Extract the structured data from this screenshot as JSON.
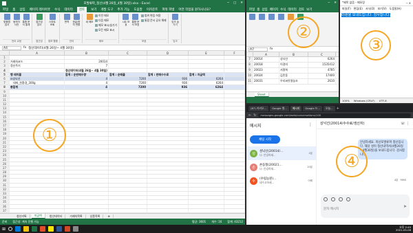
{
  "excel_main": {
    "title": "포발류파_청산(4월 26일_4월 30일).xlsx - Excel",
    "menu": [
      "파일",
      "홈",
      "삽입",
      "페이지 레이아웃",
      "수식",
      "데이터",
      "검토",
      "보기",
      "개발 도구",
      "추가 기능",
      "도움말",
      "이카운트",
      "파워 피벗",
      "어떤 작업을 원하시나요?"
    ],
    "active_menu": "검토",
    "ribbon_groups": [
      {
        "label": "언어 교정",
        "buttons": [
          "맞춤법 검사",
          "동의어 사전",
          "통합 문서 통계"
        ]
      },
      {
        "label": "접근성",
        "buttons": [
          "접근성 검사"
        ]
      },
      {
        "label": "정보 활용",
        "buttons": [
          "스마트 조회"
        ]
      },
      {
        "label": "언어",
        "buttons": [
          "번역",
          "한글/한자 변환"
        ]
      },
      {
        "label": "메모",
        "buttons": [
          "새 메모"
        ],
        "items": [
          "이전 메모",
          "다음 메모",
          "메모 표시/숨기기",
          "모든 메모 표시"
        ]
      },
      {
        "label": "보호",
        "buttons": [
          "시트 보호",
          "통합 문서 보호"
        ],
        "items": [
          "범위 편집 허용",
          "통합 문서 공유 해제"
        ]
      },
      {
        "label": "잉크",
        "buttons": [
          "잉크 숨기기"
        ]
      }
    ],
    "name_box": "A4",
    "formula": "청산데이터(4월 26일~ 4월 30일)",
    "col_headers": [
      "A",
      "B",
      "C",
      "D",
      "E",
      "F"
    ],
    "rows": [
      {
        "n": "1",
        "cells": [
          "",
          "",
          "",
          "",
          "",
          ""
        ]
      },
      {
        "n": "2",
        "cells": [
          "거래처코드",
          "20014",
          "",
          "",
          "",
          ""
        ]
      },
      {
        "n": "3",
        "cells": [
          "정산주기",
          "7",
          "",
          "",
          "",
          ""
        ]
      },
      {
        "n": "4",
        "cells": [
          "",
          "청산데이터(4월 26일~ 4월 30일)",
          "",
          "",
          "",
          ""
        ]
      },
      {
        "n": "5",
        "cells": [
          "행 레이블",
          "합계 : 순판매수량",
          "합계 : 순매출",
          "합계 : 판매수수료",
          "합계 : 지급액",
          ""
        ]
      },
      {
        "n": "6",
        "cells": [
          "⊟성낙선",
          "4",
          "7200",
          "936",
          "6264",
          ""
        ]
      },
      {
        "n": "7",
        "cells": [
          "대파_친환경_300g",
          "4",
          "7200",
          "936",
          "6264",
          ""
        ]
      },
      {
        "n": "8",
        "cells": [
          "총합계",
          "4",
          "7200",
          "936",
          "6264",
          ""
        ]
      }
    ],
    "empty_rows": [
      "9",
      "10",
      "11",
      "12",
      "13",
      "14",
      "15",
      "16",
      "17",
      "18",
      "19",
      "20",
      "21",
      "22",
      "23",
      "24",
      "25",
      "26",
      "27",
      "28",
      "29",
      "30",
      "31",
      "32",
      "33",
      "34",
      "35",
      "36",
      "37"
    ],
    "sheet_tabs": [
      "청산카톡",
      "지급액",
      "청산데이터",
      "거래처목록",
      "상품목록"
    ],
    "active_tab": "지급액",
    "status": {
      "ready": "준비",
      "avg": "평균: 3601",
      "count": "개수: 16",
      "sum": "합계: 43212",
      "access": "접근성: 계속 진행 가능"
    }
  },
  "excel_small": {
    "menu": [
      "파일",
      "홈",
      "삽입",
      "페이지",
      "수식",
      "데이터",
      "검토",
      "보기"
    ],
    "name_box": "A7",
    "col_headers": [
      "A",
      "B",
      "C"
    ],
    "rows": [
      {
        "n": "7",
        "cells": [
          "20014",
          "성낙선",
          "6264"
        ]
      },
      {
        "n": "8",
        "cells": [
          "20018",
          "이경미",
          "1535412"
        ]
      },
      {
        "n": "9",
        "cells": [
          "20023",
          "서명희",
          "4785"
        ]
      },
      {
        "n": "10",
        "cells": [
          "20024",
          "김민동",
          "17400"
        ]
      },
      {
        "n": "11",
        "cells": [
          "20031",
          "우리씨앗영농조",
          "2610"
        ]
      }
    ],
    "tab": "Sheet"
  },
  "notepad": {
    "title": "*제목 없음 - 메모장",
    "menu": [
      "파일(F)",
      "편집(E)",
      "서식(O)",
      "보기(V)",
      "도움말(H)"
    ],
    "text_plain": "",
    "text_selected": "0)원을 보내드립니다. 감사합니다.",
    "status": [
      "100%",
      "Windows (CRLF)",
      "UTF-8"
    ]
  },
  "chrome": {
    "tabs": [
      "(87) 카카오...",
      "Google 캘...",
      "메시지",
      "Google 드...",
      "오늘..."
    ],
    "active_tab": "메시지",
    "url": "messages.google.com/web/conversations/100",
    "sidebar_title": "메시지",
    "chat_start": "채팅 시작",
    "conversations": [
      {
        "avatar": "성",
        "name": "성낙선(20014/...",
        "preview": "나: 안녕하세...",
        "time": "4분",
        "color": "#7cb342"
      },
      {
        "avatar": "손",
        "name": "손동철(20021...",
        "preview": "나: 안녕하세...",
        "time": "20분",
        "color": "#e67c73"
      },
      {
        "avatar": "수",
        "name": "(수립농원)...",
        "preview": "네수고하세...",
        "time": "어제",
        "color": "#f4511e"
      }
    ],
    "conversation_title": "성낙선(20014/수수료/생산자)",
    "bubble": "안녕하세요. 피산포발류파 청산입니다. 해당 성이 청산내역서(4월26일~4월30일)을 보내드립니다. 감사합니다.",
    "bubble_meta": "4분 · MMS",
    "compose_placeholder": "문자 메시지"
  },
  "taskbar": {
    "time": "오후 2:40",
    "date": "2021-05-06"
  },
  "markers": [
    "①",
    "②",
    "③",
    "④"
  ]
}
